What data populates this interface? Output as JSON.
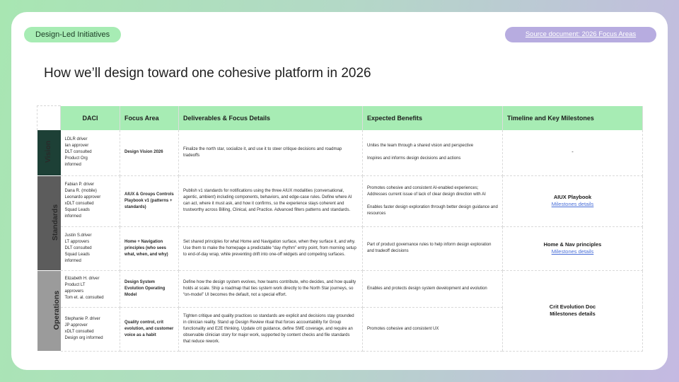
{
  "header": {
    "section_pill": "Design-Led Initiatives",
    "source_link": "Source document: 2026 Focus Areas",
    "title": "How we’ll design toward one cohesive platform in 2026"
  },
  "table": {
    "columns": [
      "DACI",
      "Focus Area",
      "Deliverables & Focus Details",
      "Expected Benefits",
      "Timeline and Key Milestones"
    ],
    "categories": [
      "Vision",
      "Standards",
      "Operations"
    ],
    "rows": [
      {
        "daci": [
          "LDLR driver",
          "Ian approver",
          "DLT consulted",
          "Product Org",
          "informed"
        ],
        "focus": "Design Vision 2026",
        "details": "Finalize the north star, socialize it, and use it to steer critique decisions and roadmap tradeoffs",
        "benefits": [
          "Unites the team through a shared vision and perspective",
          "Inspires and  informs design decisions and actions"
        ],
        "timeline_title": "-"
      },
      {
        "daci": [
          "Fabian P. driver",
          "Dana R. (mobile)",
          "Leonardo approver",
          "xDLT consulted",
          "Squad Leads",
          "informed"
        ],
        "focus": "AIUX & Groups Controls Playbook v1 (patterns + standards)",
        "details": "Publish v1 standards for notifications using the three AIUX modalities (conversational, agentic, ambient) including components, behaviors, and edge-case rules. Define where AI can act, where it must ask, and how it confirms, so the experience stays coherent and trustworthy across Billing, Clinical, and Practice. Advanced filters patterns and standards.",
        "benefits": [
          "Promotes cohesive and consistent AI-enabled experiences; Addresses current issue of lack of clear design direction with AI",
          "Enables faster design exploration through better design guidance and resources"
        ],
        "timeline_title": "AIUX Playbook",
        "timeline_link": "Milestones details"
      },
      {
        "daci": [
          "Justin S.driver",
          "LT approvers",
          "DLT consulted",
          "Squad Leads",
          "informed"
        ],
        "focus": "Home + Navigation principles (who sees what, when, and why)",
        "details": "Set shared principles for what Home and Navigation surface, when they surface it, and why. Use them to make the homepage a predictable “day rhythm” entry point, from morning setup to end-of-day wrap, while preventing drift into one-off widgets and competing surfaces.",
        "benefits": [
          "Part of product governance rules to help inform design exploration and tradeoff decisions"
        ],
        "timeline_title": "Home & Nav principles",
        "timeline_link": "Milestones details"
      },
      {
        "daci": [
          "Elizabeth H. driver",
          "Product LT",
          "approvers",
          "Tom et. al. consulted"
        ],
        "focus": "Design System Evolution Operating Model",
        "details": "Define how the design system evolves, how teams contribute, who decides, and how quality holds at scale. Ship a roadmap that ties system work directly to the North Star journeys, so “on-model” UI becomes the default, not a special effort.",
        "benefits": [
          "Enables and protects design system development and evolution"
        ],
        "timeline_title": ""
      },
      {
        "daci": [
          "Stephanie P. driver",
          "JP approver",
          "xDLT consulted",
          "Design org informed"
        ],
        "focus": "Quality control, crit evolution, and customer voice as a habit",
        "details": "Tighten critique and quality practices so standards are explicit and decisions stay grounded in clinician reality. Stand up Design Review ritual that forces accountability for Group functionality and E2E  thinking. Update crit guidance, define SME coverage, and require an observable clinician story for major work, supported by content checks and file standards that reduce rework.",
        "benefits": [
          "Promotes cohesive and consistent UX"
        ],
        "timeline_title": "Crit Evolution Doc",
        "timeline_plain": "Milestones details"
      }
    ]
  },
  "colors": {
    "header_green": "#a7ecb4",
    "vision": "#1d4036",
    "standards": "#5c5c5c",
    "operations": "#9b9b9b",
    "link_purple_pill": "#b7ace0",
    "link_blue": "#4a6fd8"
  }
}
